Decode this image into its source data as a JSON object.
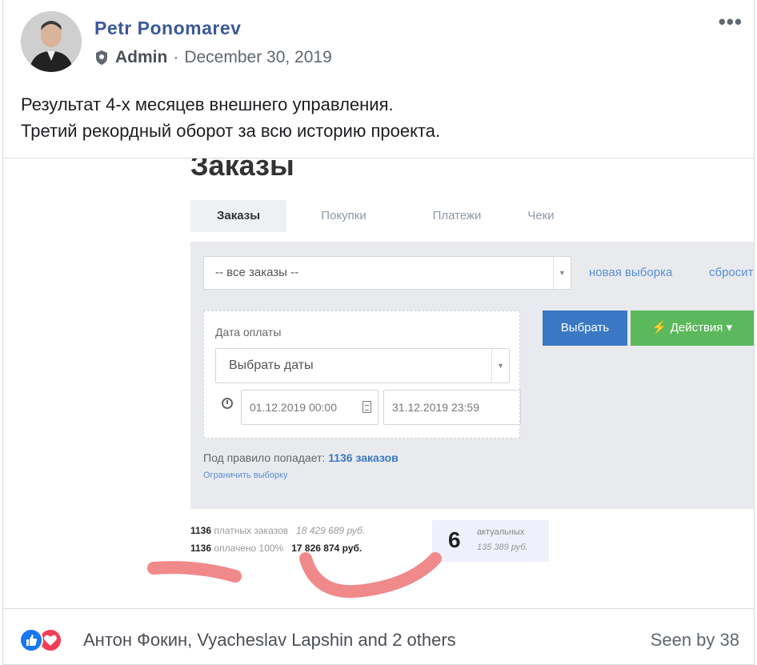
{
  "post": {
    "author": "Petr Ponomarev",
    "role": "Admin",
    "separator": "·",
    "date": "December 30, 2019",
    "more": "•••",
    "text_line1": "Результат 4-х месяцев внешнего управления.",
    "text_line2": "Третий рекордный оборот за всю историю проекта."
  },
  "screenshot": {
    "title": "Заказы",
    "tabs": [
      "Заказы",
      "Покупки",
      "Платежи",
      "Чеки"
    ],
    "filter_value": "-- все заказы --",
    "link_new": "новая выборка",
    "link_reset": "сбросить",
    "date_label": "Дата оплаты",
    "date_select": "Выбрать даты",
    "date_from": "01.12.2019 00:00",
    "date_to": "31.12.2019 23:59",
    "btn_select": "Выбрать",
    "btn_actions": "⚡ Действия ▾",
    "rule_prefix": "Под правило попадает: ",
    "rule_count": "1136 заказов",
    "limit_link": "Ограничить выборку",
    "stats": {
      "row1_count": "1136",
      "row1_label": "платных заказов",
      "row1_sum": "18 429 689 руб.",
      "row2_count": "1136",
      "row2_label": "оплачено 100%",
      "row2_sum": "17 826 874 руб."
    },
    "actual": {
      "count": "6",
      "label": "актуальных",
      "sum": "135 389 руб."
    },
    "annotation_color": "#f08a8a"
  },
  "footer": {
    "reactions": [
      "like-icon",
      "love-icon"
    ],
    "names": "Антон Фокин, Vyacheslav Lapshin and 2 others",
    "seen": "Seen by 38"
  },
  "colors": {
    "brand": "#3b5998",
    "like": "#1877f2",
    "love": "#f33e58",
    "btn_blue": "#3a78c3",
    "btn_green": "#5cb85c"
  }
}
